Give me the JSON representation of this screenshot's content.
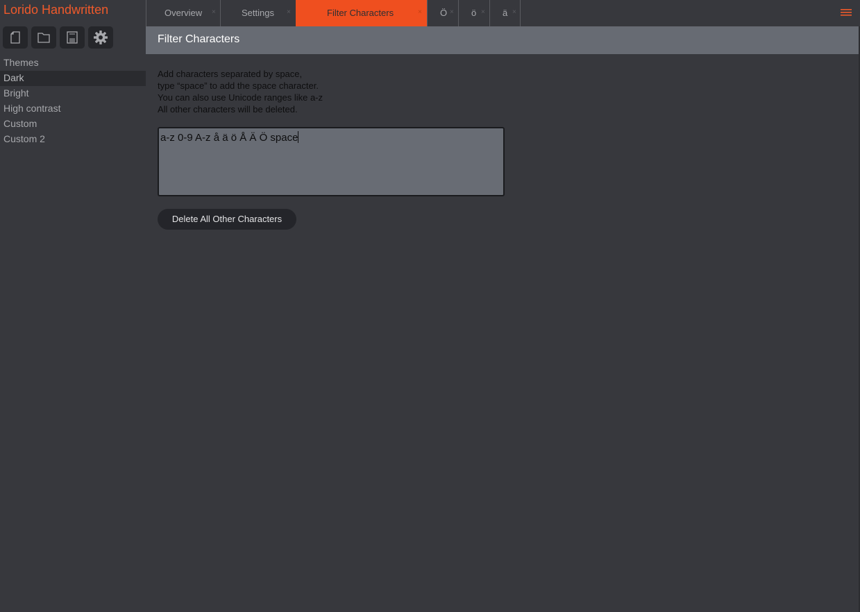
{
  "app": {
    "title": "Lorido Handwritten",
    "accent_color": "#ef5a2b"
  },
  "toolbar": {
    "buttons": [
      {
        "icon": "new-file-icon"
      },
      {
        "icon": "folder-icon"
      },
      {
        "icon": "save-icon"
      },
      {
        "icon": "gear-icon"
      }
    ]
  },
  "sidebar": {
    "heading": "Themes",
    "items": [
      "Dark",
      "Bright",
      "High contrast",
      "Custom",
      "Custom 2"
    ],
    "selected": "Dark"
  },
  "tabs": {
    "items": [
      {
        "label": "Overview",
        "close": "×"
      },
      {
        "label": "Settings",
        "close": "×"
      },
      {
        "label": "Filter Characters",
        "close": "×"
      },
      {
        "label": "Ö",
        "close": "×"
      },
      {
        "label": "ö",
        "close": "×"
      },
      {
        "label": "ä",
        "close": "×"
      }
    ],
    "active": "Filter Characters",
    "active_color": "#ef4f1f"
  },
  "panel": {
    "title": "Filter Characters",
    "instructions": [
      "Add characters separated by space,",
      "type “space” to add the space character.",
      "You can also use Unicode ranges like a-z",
      "All other characters will be deleted."
    ],
    "input_value": "a-z 0-9 A-z å ä ö Å Ä Ö space",
    "button_label": "Delete All Other Characters"
  }
}
